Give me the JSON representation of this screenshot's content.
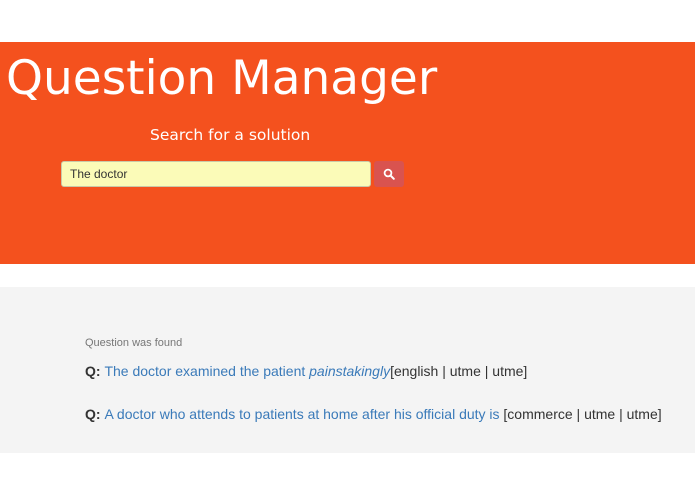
{
  "hero": {
    "title": "Question Manager",
    "subtitle": "Search for a solution",
    "background_color": "#f4511e"
  },
  "search": {
    "value": "The doctor",
    "button_icon": "search-icon",
    "button_color": "#d9534f"
  },
  "results": {
    "status": "Question was found",
    "prefix": "Q:",
    "items": [
      {
        "text": "The doctor examined the patient ",
        "emphasis": "painstakingly",
        "tags": "[english | utme | utme]"
      },
      {
        "text": "A doctor who attends to patients at home after his official duty is",
        "emphasis": "",
        "tags": " [commerce | utme | utme]"
      }
    ],
    "link_color": "#3a7ab9"
  }
}
